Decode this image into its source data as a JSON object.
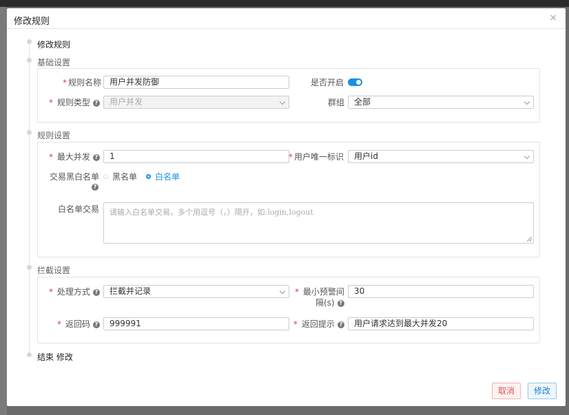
{
  "dialog": {
    "title": "修改规则",
    "close_icon": "×"
  },
  "steps": {
    "start": "修改规则",
    "end": "结束 修改"
  },
  "basic": {
    "title": "基础设置",
    "rule_name_label": "规则名称",
    "rule_name_value": "用户并发防御",
    "enabled_label": "是否开启",
    "enabled": true,
    "rule_type_label": "规则类型",
    "rule_type_value": "用户并发",
    "group_label": "群组",
    "group_value": "全部"
  },
  "rule": {
    "title": "规则设置",
    "max_concurrent_label": "最大并发",
    "max_concurrent_value": "1",
    "user_id_label": "用户唯一标识",
    "user_id_value": "用户id",
    "list_type_label": "交易黑白名单",
    "blacklist_option": "黑名单",
    "whitelist_option": "白名单",
    "selected_option": "白名单",
    "whitelist_label": "白名单交易",
    "whitelist_placeholder": "请输入白名单交易，多个用逗号（，）隔开，如:login,logout"
  },
  "intercept": {
    "title": "拦截设置",
    "handle_label": "处理方式",
    "handle_value": "拦截并记录",
    "min_interval_label_1": "最小预警间",
    "min_interval_label_2": "隔(s)",
    "min_interval_value": "30",
    "return_code_label": "返回码",
    "return_code_value": "999991",
    "return_msg_label": "返回提示",
    "return_msg_value": "用户请求达到最大并发20"
  },
  "buttons": {
    "cancel": "取消",
    "submit": "修改"
  },
  "colors": {
    "accent": "#1a8fe3",
    "required": "#e03b3b"
  },
  "icons": {
    "help": "question-circle-icon",
    "caret": "chevron-down-icon",
    "close": "close-icon"
  }
}
